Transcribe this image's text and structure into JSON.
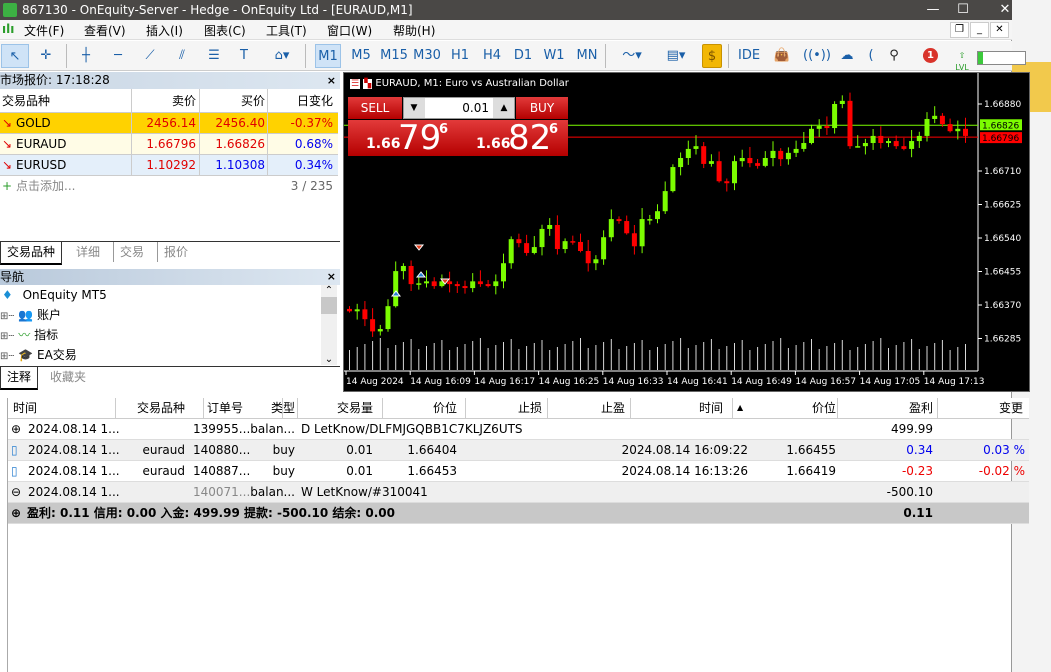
{
  "title": "867130 - OnEquity-Server - Hedge - OnEquity Ltd - [EURAUD,M1]",
  "window_controls": {
    "minimize": "—",
    "maximize": "☐",
    "close": "✕"
  },
  "menu": [
    "文件(F)",
    "查看(V)",
    "插入(I)",
    "图表(C)",
    "工具(T)",
    "窗口(W)",
    "帮助(H)"
  ],
  "mdi_controls": [
    "_",
    "❐",
    "✕"
  ],
  "timeframes": [
    "M1",
    "M5",
    "M15",
    "M30",
    "H1",
    "H4",
    "D1",
    "W1",
    "MN"
  ],
  "active_timeframe": "M1",
  "toolbar": {
    "ide": "IDE",
    "notification_count": "1",
    "lvl": "LVL",
    "level_progress": 0.1
  },
  "market_watch": {
    "title": "市场报价: 17:18:28",
    "columns": [
      "交易品种",
      "卖价",
      "买价",
      "日变化"
    ],
    "rows": [
      {
        "symbol": "GOLD",
        "bid": "2456.14",
        "ask": "2456.40",
        "change": "-0.37%",
        "bg": "#ffd200",
        "bid_color": "#e00000",
        "ask_color": "#e00000",
        "change_color": "#e00000"
      },
      {
        "symbol": "EURAUD",
        "bid": "1.66796",
        "ask": "1.66826",
        "change": "0.68%",
        "bg": "#fffce6",
        "bid_color": "#e00000",
        "ask_color": "#e00000",
        "change_color": "#0000ee"
      },
      {
        "symbol": "EURUSD",
        "bid": "1.10292",
        "ask": "1.10308",
        "change": "0.34%",
        "bg": "#e4effa",
        "bid_color": "#e00000",
        "ask_color": "#0000ee",
        "change_color": "#0000ee"
      }
    ],
    "add_label": "点击添加...",
    "count": "3 / 235",
    "tabs": [
      "交易品种",
      "详细",
      "交易",
      "报价"
    ]
  },
  "navigator": {
    "title": "导航",
    "root": "OnEquity MT5",
    "items": [
      "账户",
      "指标",
      "EA交易"
    ],
    "tabs": [
      "注释",
      "收藏夹"
    ]
  },
  "chart": {
    "title": "EURAUD, M1:  Euro vs Australian Dollar",
    "sell_label": "SELL",
    "buy_label": "BUY",
    "lot": "0.01",
    "sell_price": {
      "prefix": "1.66",
      "big": "79",
      "sup": "6"
    },
    "buy_price": {
      "prefix": "1.66",
      "big": "82",
      "sup": "6"
    },
    "ask_line": "1.66826",
    "bid_line": "1.66796",
    "up_color": "#7cfc00",
    "down_color": "#ff0000"
  },
  "chart_data": {
    "type": "candlestick",
    "symbol": "EURAUD",
    "timeframe": "M1",
    "y_ticks": [
      "1.66880",
      "1.66710",
      "1.66625",
      "1.66540",
      "1.66455",
      "1.66370",
      "1.66285"
    ],
    "ylim": [
      1.662,
      1.6693
    ],
    "x_ticks": [
      "14 Aug 2024",
      "14 Aug 16:09",
      "14 Aug 16:17",
      "14 Aug 16:25",
      "14 Aug 16:33",
      "14 Aug 16:41",
      "14 Aug 16:49",
      "14 Aug 16:57",
      "14 Aug 17:05",
      "14 Aug 17:13"
    ],
    "closes": [
      1.66354,
      1.66359,
      1.66334,
      1.66303,
      1.66309,
      1.66367,
      1.66456,
      1.66469,
      1.66423,
      1.66425,
      1.6643,
      1.66418,
      1.6643,
      1.66423,
      1.66418,
      1.66413,
      1.6643,
      1.66423,
      1.66418,
      1.6643,
      1.66476,
      1.66537,
      1.66527,
      1.66502,
      1.66517,
      1.66563,
      1.66573,
      1.66512,
      1.66532,
      1.6653,
      1.66507,
      1.66476,
      1.66486,
      1.66542,
      1.66588,
      1.66583,
      1.66552,
      1.66519,
      1.66588,
      1.66588,
      1.66608,
      1.66659,
      1.6672,
      1.66743,
      1.66766,
      1.66773,
      1.66728,
      1.66735,
      1.66684,
      1.66679,
      1.66735,
      1.66743,
      1.6673,
      1.66723,
      1.66743,
      1.66761,
      1.6674,
      1.66756,
      1.66766,
      1.66781,
      1.66817,
      1.66824,
      1.66819,
      1.6688,
      1.66888,
      1.66773,
      1.66773,
      1.66781,
      1.66799,
      1.66781,
      1.66786,
      1.66773,
      1.66766,
      1.66786,
      1.66799,
      1.66842,
      1.6685,
      1.66829,
      1.66811,
      1.66817,
      1.66799
    ],
    "ask": 1.66826,
    "bid": 1.66796
  },
  "terminal": {
    "columns": [
      "时间",
      "交易品种",
      "订单号",
      "类型",
      "交易量",
      "价位",
      "止损",
      "止盈",
      "时间",
      "价位",
      "盈利",
      "变更"
    ],
    "rows": [
      {
        "icon": "⊕",
        "time": "2024.08.14 1...",
        "symbol": "",
        "ticket": "139955...",
        "type": "balan...",
        "comment": "D LetKnow/DLFMJGQBB1C7KLJZ6UTS",
        "profit": "499.99",
        "profit_color": "#000"
      },
      {
        "icon": "▯",
        "time": "2024.08.14 1...",
        "symbol": "euraud",
        "ticket": "140880...",
        "type": "buy",
        "volume": "0.01",
        "price": "1.66404",
        "close_time": "2024.08.14 16:09:22",
        "close_price": "1.66455",
        "profit": "0.34",
        "change": "0.03 %",
        "profit_color": "#0000ee"
      },
      {
        "icon": "▯",
        "time": "2024.08.14 1...",
        "symbol": "euraud",
        "ticket": "140887...",
        "type": "buy",
        "volume": "0.01",
        "price": "1.66453",
        "close_time": "2024.08.14 16:13:26",
        "close_price": "1.66419",
        "profit": "-0.23",
        "change": "-0.02 %",
        "profit_color": "#ee0000"
      },
      {
        "icon": "⊖",
        "time": "2024.08.14 1...",
        "symbol": "",
        "ticket": "140071...",
        "type": "balan...",
        "comment": "W LetKnow/#310041",
        "profit": "-500.10",
        "profit_color": "#000"
      }
    ],
    "summary": "盈利: 0.11  信用: 0.00  入金: 499.99  提款: -500.10  结余: 0.00",
    "summary_total": "0.11"
  }
}
